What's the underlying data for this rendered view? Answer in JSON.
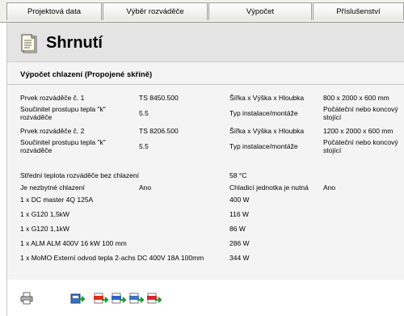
{
  "tabs": [
    {
      "label": "Projektová data"
    },
    {
      "label": "Výběr rozváděče"
    },
    {
      "label": "Výpočet"
    },
    {
      "label": "Příslušenství"
    }
  ],
  "page": {
    "title": "Shrnutí"
  },
  "section": {
    "title": "Výpočet chlazení (Propojené skříně)",
    "rows": [
      {
        "label": "Prvek rozváděče č. 1",
        "value": "TS 8450.500",
        "label2": "Šířka x Výška x Hloubka",
        "value2": "800 x 2000 x 600 mm"
      },
      {
        "label": "Součinitel prostupu tepla \"k\" rozváděče",
        "value": "5.5",
        "label2": "Typ instalace/montáže",
        "value2": "Počáteční nebo koncový stojící"
      },
      {
        "label": "Prvek rozváděče č. 2",
        "value": "TS 8206.500",
        "label2": "Šířka x Výška x Hloubka",
        "value2": "1200 x 2000 x 600 mm"
      },
      {
        "label": "Součinitel prostupu tepla \"k\" rozváděče",
        "value": "5.5",
        "label2": "Typ instalace/montáže",
        "value2": "Počáteční nebo koncový stojící"
      }
    ],
    "temp_label": "Střední teplota rozváděče bez chlazení",
    "temp_value": "58 °C",
    "cooling_label": "Je nezbytné chlazení",
    "cooling_value": "Ano",
    "unit_label": "Chladicí jednotka je nutná",
    "unit_value": "Ano",
    "components": [
      {
        "name": "1 x DC master 4Q 125A",
        "power": "400 W"
      },
      {
        "name": "1 x G120 1,5kW",
        "power": "116 W"
      },
      {
        "name": "1 x G120 1,1kW",
        "power": "86 W"
      },
      {
        "name": "1 x ALM ALM 400V 16 kW 100 mm",
        "power": "286 W"
      },
      {
        "name": "1 x MoMO Externí odvod tepla 2-achs DC 400V 18A 100mm",
        "power": "344 W"
      }
    ]
  },
  "footer": {
    "icons": [
      "printer-icon",
      "export-icon",
      "export-xml-icon",
      "export-rtf-icon",
      "export-txt-icon",
      "export-pdf-icon"
    ]
  }
}
